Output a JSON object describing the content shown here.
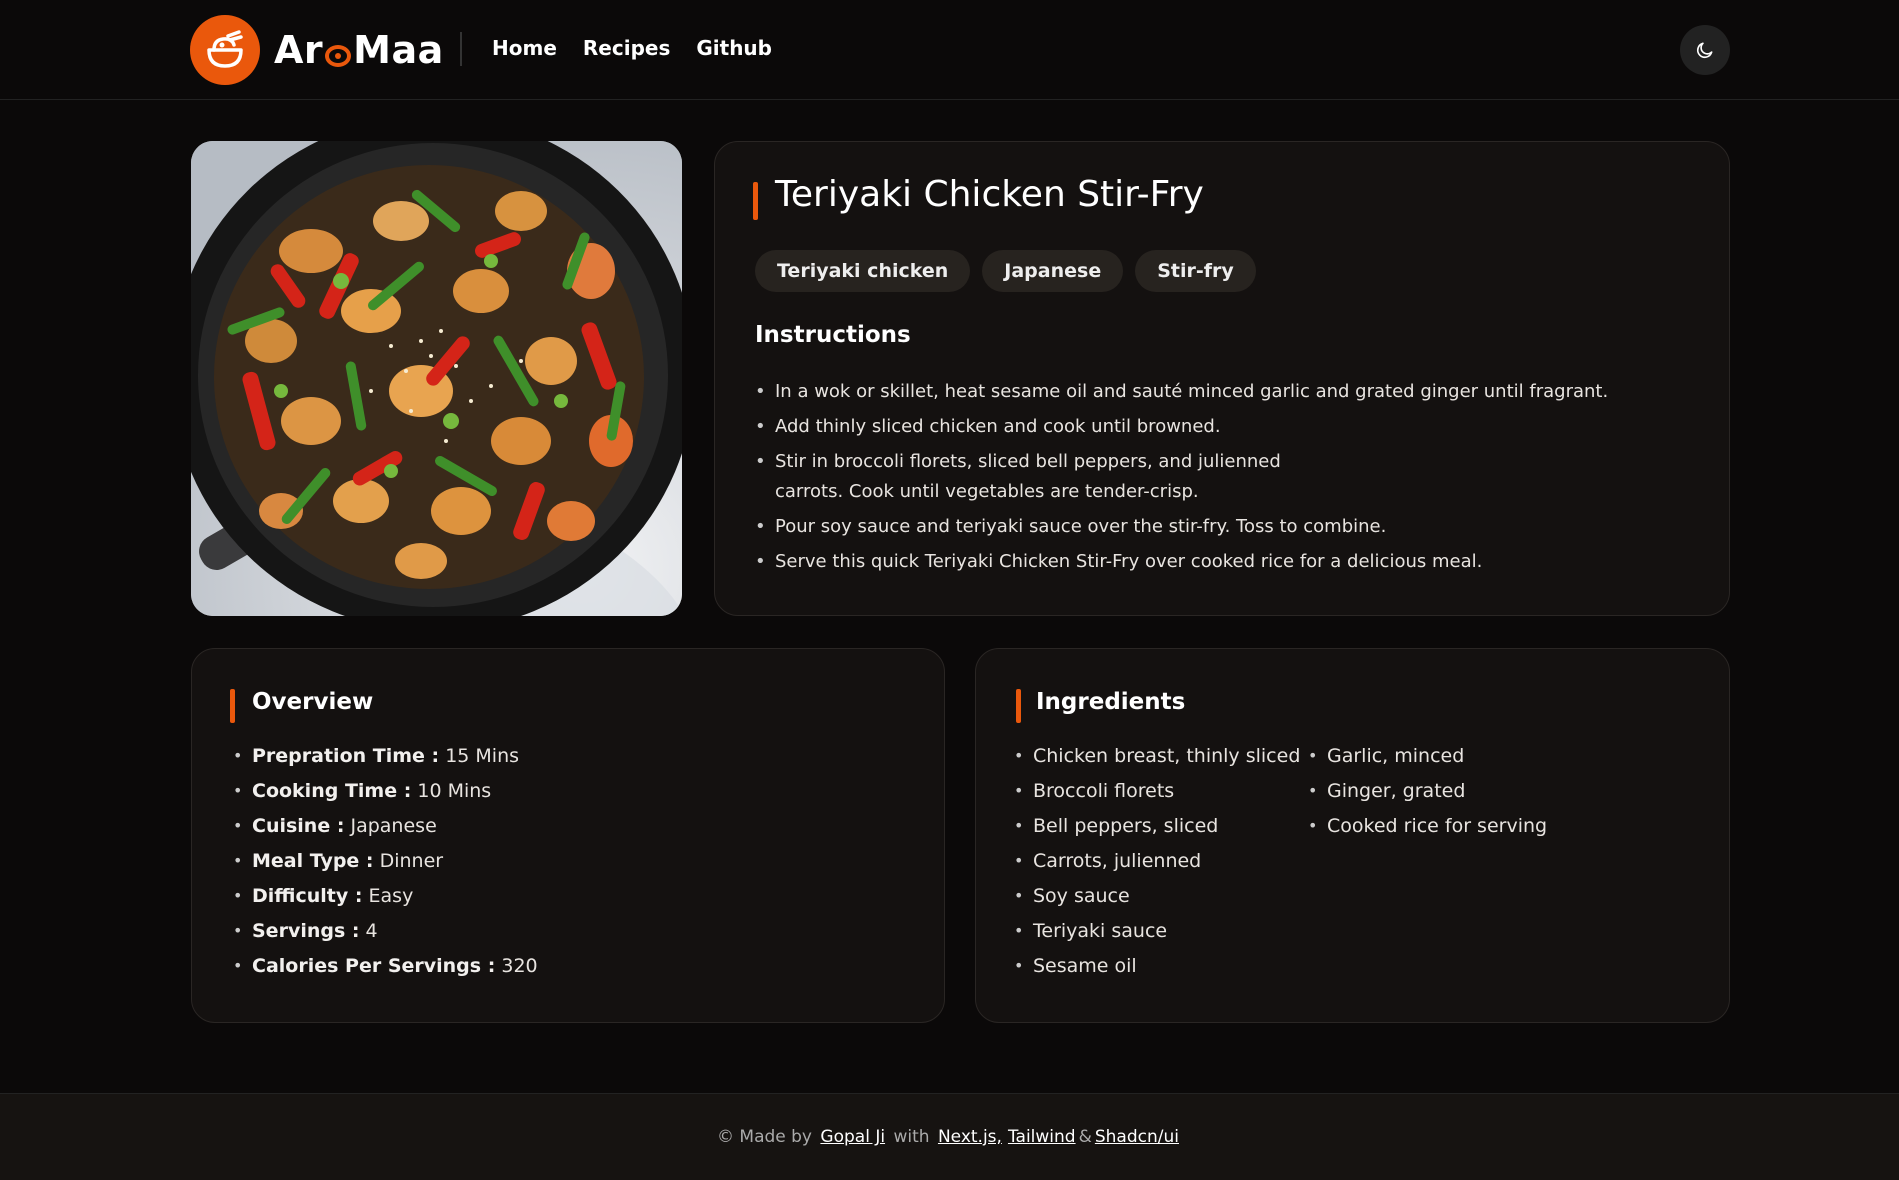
{
  "header": {
    "brand_prefix": "Ar",
    "brand_suffix": "Maa",
    "nav": [
      "Home",
      "Recipes",
      "Github"
    ],
    "theme_icon": "moon-icon"
  },
  "recipe": {
    "title": "Teriyaki Chicken Stir-Fry",
    "tags": [
      "Teriyaki chicken",
      "Japanese",
      "Stir-fry"
    ],
    "instructions_heading": "Instructions",
    "instructions": [
      "In a wok or skillet, heat sesame oil and sauté minced garlic and grated ginger until fragrant.",
      "Add thinly sliced chicken and cook until browned.",
      "Stir in broccoli florets, sliced bell peppers, and julienned carrots. Cook until vegetables are tender-crisp.",
      "Pour soy sauce and teriyaki sauce over the stir-fry. Toss to combine.",
      "Serve this quick Teriyaki Chicken Stir-Fry over cooked rice for a delicious meal."
    ]
  },
  "overview": {
    "heading": "Overview",
    "items": [
      {
        "label": "Prepration Time :",
        "value": "15 Mins"
      },
      {
        "label": "Cooking Time :",
        "value": "10 Mins"
      },
      {
        "label": "Cuisine :",
        "value": "Japanese"
      },
      {
        "label": "Meal Type :",
        "value": "Dinner"
      },
      {
        "label": "Difficulty :",
        "value": "Easy"
      },
      {
        "label": "Servings :",
        "value": "4"
      },
      {
        "label": "Calories Per Servings :",
        "value": "320"
      }
    ]
  },
  "ingredients": {
    "heading": "Ingredients",
    "col1": [
      "Chicken breast, thinly sliced",
      "Broccoli florets",
      "Bell peppers, sliced",
      "Carrots, julienned",
      "Soy sauce",
      "Teriyaki sauce",
      "Sesame oil"
    ],
    "col2": [
      "Garlic, minced",
      "Ginger, grated",
      "Cooked rice for serving"
    ]
  },
  "footer": {
    "prefix": "© Made by",
    "author": "Gopal Ji",
    "with": "with",
    "tech1": "Next.js,",
    "tech2": "Tailwind",
    "amp": "&",
    "tech3": "Shadcn/ui"
  },
  "colors": {
    "accent": "#ea580c",
    "background": "#0b0909",
    "card": "#141110"
  }
}
